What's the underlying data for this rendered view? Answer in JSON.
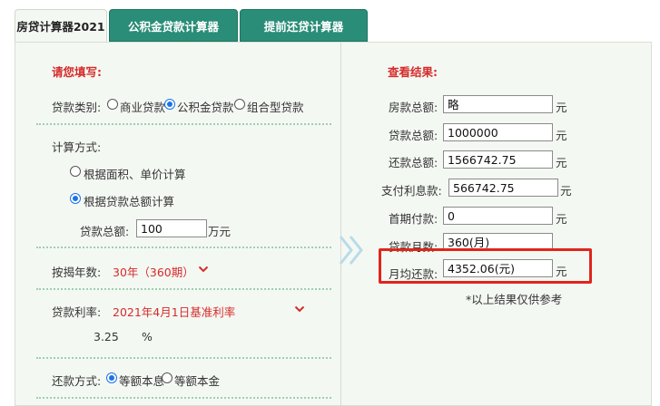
{
  "tabs": [
    {
      "label": "房贷计算器2021",
      "active": true
    },
    {
      "label": "公积金贷款计算器",
      "active": false
    },
    {
      "label": "提前还贷计算器",
      "active": false
    }
  ],
  "left": {
    "section_title": "请您填写:",
    "loan_type": {
      "label": "贷款类别:",
      "options": [
        "商业贷款",
        "公积金贷款",
        "组合型贷款"
      ],
      "selected": "公积金贷款"
    },
    "calc_method": {
      "label": "计算方式:",
      "options": [
        "根据面积、单价计算",
        "根据贷款总额计算"
      ],
      "selected": "根据贷款总额计算"
    },
    "loan_total": {
      "label": "贷款总额:",
      "value": "100",
      "unit": "万元"
    },
    "years": {
      "label": "按揭年数:",
      "value": "30年（360期）"
    },
    "rate": {
      "label": "贷款利率:",
      "value": "2021年4月1日基准利率",
      "number": "3.25",
      "unit": "%"
    },
    "repay_method": {
      "label": "还款方式:",
      "options": [
        "等额本息",
        "等额本金"
      ],
      "selected": "等额本息"
    }
  },
  "right": {
    "section_title": "查看结果:",
    "rows": [
      {
        "label": "房款总额:",
        "value": "略",
        "unit": "元"
      },
      {
        "label": "贷款总额:",
        "value": "1000000",
        "unit": "元"
      },
      {
        "label": "还款总额:",
        "value": "1566742.75",
        "unit": "元"
      },
      {
        "label": "支付利息款:",
        "value": "566742.75",
        "unit": "元"
      },
      {
        "label": "首期付款:",
        "value": "0",
        "unit": "元"
      },
      {
        "label": "贷款月数:",
        "value": "360(月)",
        "unit": ""
      },
      {
        "label": "月均还款:",
        "value": "4352.06(元)",
        "unit": "元"
      }
    ],
    "note": "*以上结果仅供参考"
  },
  "colors": {
    "accent_red": "#d62b2b",
    "tab_green": "#2a8d78",
    "panel_bg": "#f4f8f3",
    "highlight_red": "#e0251b",
    "radio_blue": "#1a73e8"
  }
}
